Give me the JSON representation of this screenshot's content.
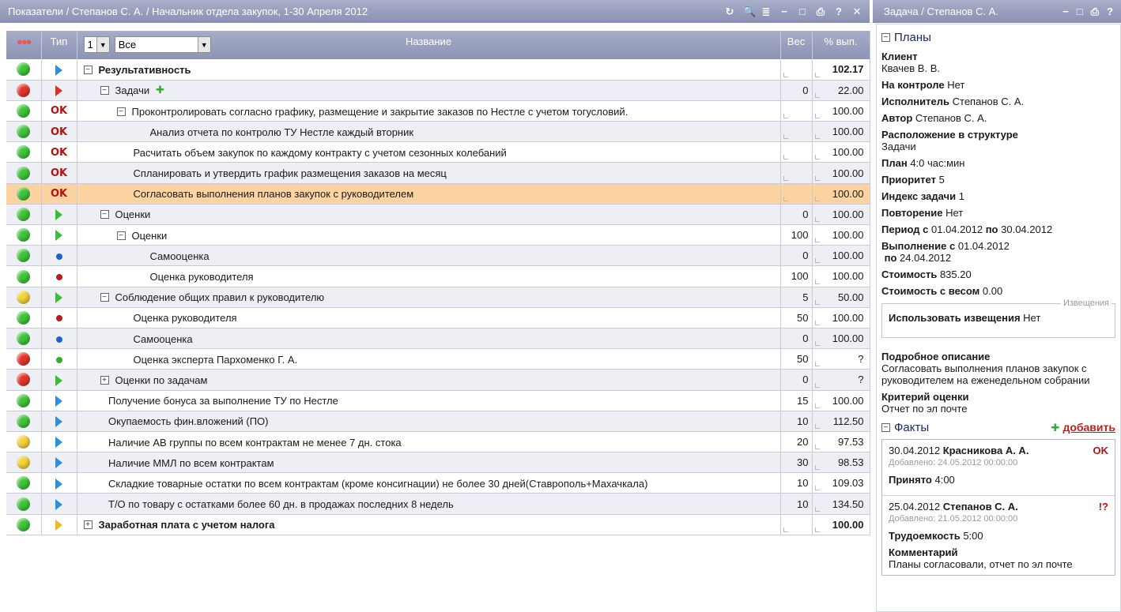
{
  "left": {
    "title": "Показатели / Степанов С. А. / Начальник отдела закупок, 1-30 Апреля 2012",
    "tools": [
      "↻",
      "🔍",
      "≣",
      "−",
      "□",
      "⎙",
      "?",
      "✕"
    ],
    "header": {
      "status": "●●●",
      "type": "Тип",
      "level_value": "1",
      "filter_value": "Все",
      "name": "Название",
      "weight": "Вес",
      "pct": "% вып."
    },
    "rows": [
      {
        "status": "green",
        "type": "tri-blue",
        "indent": 0,
        "expander": "⊟",
        "name": "Результативность",
        "bold": true,
        "weight": "",
        "pct": "102.17"
      },
      {
        "status": "red",
        "type": "tri-red",
        "indent": 1,
        "expander": "⊟",
        "name": "Задачи",
        "add": "✚",
        "weight": "0",
        "pct": "22.00"
      },
      {
        "status": "green",
        "type": "ok",
        "indent": 2,
        "expander": "⊟",
        "name": "Проконтролировать согласно графику, размещение и закрытие заказов по Нестле с учетом тогусловий.",
        "weight": "",
        "pct": "100.00"
      },
      {
        "status": "green",
        "type": "ok",
        "indent": 4,
        "expander": "",
        "name": "Анализ отчета по контролю ТУ Нестле каждый вторник",
        "weight": "",
        "pct": "100.00"
      },
      {
        "status": "green",
        "type": "ok",
        "indent": 3,
        "expander": "",
        "name": "Расчитать объем закупок по каждому контракту с учетом сезонных колебаний",
        "weight": "",
        "pct": "100.00"
      },
      {
        "status": "green",
        "type": "ok",
        "indent": 3,
        "expander": "",
        "name": "Спланировать и утвердить график размещения заказов на месяц",
        "weight": "",
        "pct": "100.00"
      },
      {
        "status": "green",
        "type": "ok",
        "indent": 3,
        "expander": "",
        "name": "Согласовать выполнения планов закупок с руководителем",
        "weight": "",
        "pct": "100.00",
        "highlight": true
      },
      {
        "status": "green",
        "type": "tri-green",
        "indent": 1,
        "expander": "⊟",
        "name": "Оценки",
        "weight": "0",
        "pct": "100.00"
      },
      {
        "status": "green",
        "type": "tri-green",
        "indent": 2,
        "expander": "⊟",
        "name": "Оценки",
        "weight": "100",
        "pct": "100.00"
      },
      {
        "status": "green",
        "type": "dot-blue",
        "indent": 4,
        "expander": "",
        "name": "Самооценка",
        "weight": "0",
        "pct": "100.00"
      },
      {
        "status": "green",
        "type": "dot-red",
        "indent": 4,
        "expander": "",
        "name": "Оценка руководителя",
        "weight": "100",
        "pct": "100.00"
      },
      {
        "status": "yellow",
        "type": "tri-green",
        "indent": 1,
        "expander": "⊟",
        "name": "Соблюдение общих правил к руководителю",
        "weight": "5",
        "pct": "50.00"
      },
      {
        "status": "green",
        "type": "dot-red",
        "indent": 3,
        "expander": "",
        "name": "Оценка руководителя",
        "weight": "50",
        "pct": "100.00"
      },
      {
        "status": "green",
        "type": "dot-blue",
        "indent": 3,
        "expander": "",
        "name": "Самооценка",
        "weight": "0",
        "pct": "100.00"
      },
      {
        "status": "red",
        "type": "dot-green",
        "indent": 3,
        "expander": "",
        "name": "Оценка эксперта Пархоменко Г. А.",
        "weight": "50",
        "pct": "?"
      },
      {
        "status": "red",
        "type": "tri-green",
        "indent": 1,
        "expander": "⊞",
        "name": "Оценки по задачам",
        "weight": "0",
        "pct": "?"
      },
      {
        "status": "green",
        "type": "tri-blue",
        "indent": 1.5,
        "expander": "",
        "name": "Получение бонуса за выполнение ТУ по Нестле",
        "weight": "15",
        "pct": "100.00"
      },
      {
        "status": "green",
        "type": "tri-blue",
        "indent": 1.5,
        "expander": "",
        "name": "Окупаемость фин.вложений (ПО)",
        "weight": "10",
        "pct": "112.50"
      },
      {
        "status": "yellow",
        "type": "tri-blue",
        "indent": 1.5,
        "expander": "",
        "name": "Наличие АВ группы по всем контрактам не менее 7 дн. стока",
        "weight": "20",
        "pct": "97.53"
      },
      {
        "status": "yellow",
        "type": "tri-blue",
        "indent": 1.5,
        "expander": "",
        "name": "Наличие ММЛ по всем контрактам",
        "weight": "30",
        "pct": "98.53"
      },
      {
        "status": "green",
        "type": "tri-blue",
        "indent": 1.5,
        "expander": "",
        "name": "Складкие товарные остатки по всем контрактам (кроме консигнации) не более 30 дней(Ставрополь+Махачкала)",
        "weight": "10",
        "pct": "109.03"
      },
      {
        "status": "green",
        "type": "tri-blue",
        "indent": 1.5,
        "expander": "",
        "name": "Т/О по товару с остатками более 60 дн. в продажах последних 8 недель",
        "weight": "10",
        "pct": "134.50"
      },
      {
        "status": "green",
        "type": "tri-orange",
        "indent": 0,
        "expander": "⊞",
        "name": "Заработная плата с учетом налога",
        "bold": true,
        "weight": "",
        "pct": "100.00"
      }
    ]
  },
  "right": {
    "title": "Задача / Степанов С. А.",
    "tools": [
      "−",
      "□",
      "⎙",
      "?"
    ],
    "plans_title": "Планы",
    "client_label": "Клиент",
    "client_value": "Квачев В. В.",
    "control_label": "На контроле",
    "control_value": "Нет",
    "executor_label": "Исполнитель",
    "executor_value": "Степанов С. А.",
    "author_label": "Автор",
    "author_value": "Степанов С. А.",
    "location_label": "Расположение в структуре",
    "location_value": "Задачи",
    "plan_label": "План",
    "plan_value": "4:0 час:мин",
    "priority_label": "Приоритет",
    "priority_value": "5",
    "index_label": "Индекс задачи",
    "index_value": "1",
    "repeat_label": "Повторение",
    "repeat_value": "Нет",
    "period_label": "Период с",
    "period_from": "01.04.2012",
    "period_to_label": "по",
    "period_to": "30.04.2012",
    "exec_label": "Выполнение с",
    "exec_from": "01.04.2012",
    "exec_to_label": "по",
    "exec_to": "24.04.2012",
    "cost_label": "Стоимость",
    "cost_value": "835.20",
    "costw_label": "Стоимость с весом",
    "costw_value": "0.00",
    "notif_legend": "Извещения",
    "notif_label": "Использовать извещения",
    "notif_value": "Нет",
    "desc_label": "Подробное описание",
    "desc_value": "Согласовать выполнения планов закупок с руководителем на еженедельном собрании",
    "crit_label": "Критерий оценки",
    "crit_value": "Отчет по эл почте",
    "facts_title": "Факты",
    "add_label": "добавить",
    "facts": [
      {
        "date": "30.04.2012",
        "who": "Красникова А. А.",
        "badge": "OK",
        "added": "Добавлено: 24.05.2012 00:00:00",
        "k1": "Принято",
        "v1": "4:00"
      },
      {
        "date": "25.04.2012",
        "who": "Степанов С. А.",
        "badge": "!?",
        "added": "Добавлено: 21.05.2012 00:00:00",
        "k1": "Трудоемкость",
        "v1": "5:00",
        "k2": "Комментарий",
        "v2": "Планы согласовали, отчет по эл почте"
      }
    ]
  }
}
